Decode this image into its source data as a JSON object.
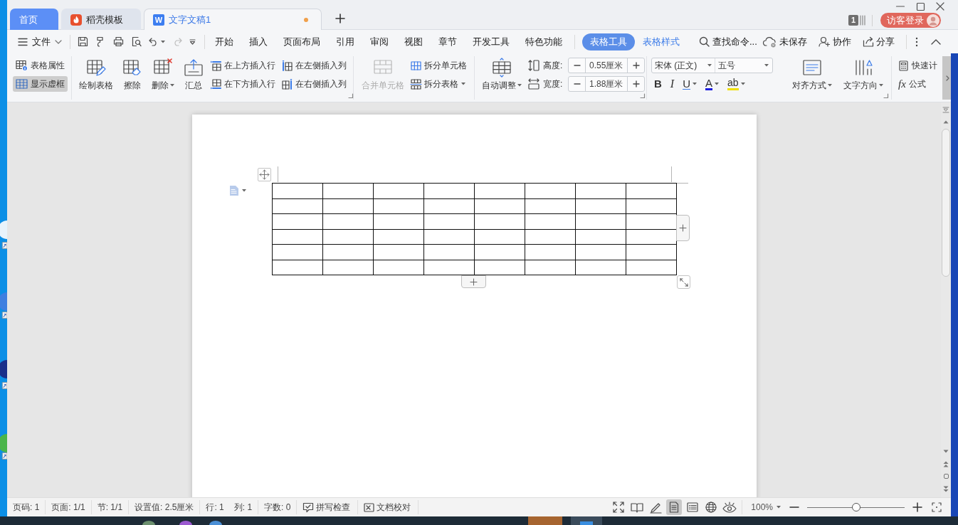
{
  "tabs": [
    {
      "kind": "home",
      "label": "首页",
      "selected": false
    },
    {
      "kind": "docer",
      "label": "稻壳模板",
      "selected": false
    },
    {
      "kind": "writer",
      "logo": "W",
      "label": "文字文稿1",
      "selected": true,
      "unsaved": true
    }
  ],
  "account": {
    "badge": "1",
    "login": "访客登录"
  },
  "menu": {
    "file": "文件",
    "tabs": [
      {
        "label": "开始",
        "selected": false,
        "contextual": false
      },
      {
        "label": "插入",
        "selected": false,
        "contextual": false
      },
      {
        "label": "页面布局",
        "selected": false,
        "contextual": false
      },
      {
        "label": "引用",
        "selected": false,
        "contextual": false
      },
      {
        "label": "审阅",
        "selected": false,
        "contextual": false
      },
      {
        "label": "视图",
        "selected": false,
        "contextual": false
      },
      {
        "label": "章节",
        "selected": false,
        "contextual": false
      },
      {
        "label": "开发工具",
        "selected": false,
        "contextual": false
      },
      {
        "label": "特色功能",
        "selected": false,
        "contextual": false
      },
      {
        "label": "表格工具",
        "selected": true,
        "contextual": true
      },
      {
        "label": "表格样式",
        "selected": false,
        "contextual": true
      }
    ],
    "search": "查找命令...",
    "actions": [
      "未保存",
      "协作",
      "分享"
    ]
  },
  "ribbon": {
    "table_buttons": [
      {
        "label": "表格属性",
        "selected": false
      },
      {
        "label": "显示虚框",
        "selected": true
      }
    ],
    "edit_buttons": [
      {
        "label": "绘制表格",
        "dropdown": false
      },
      {
        "label": "擦除",
        "dropdown": false
      },
      {
        "label": "删除",
        "dropdown": true
      },
      {
        "label": "汇总",
        "dropdown": false
      }
    ],
    "insert_buttons": [
      "在上方插入行",
      "在下方插入行",
      "在左侧插入列",
      "在右侧插入列"
    ],
    "merge_buttons": [
      {
        "label": "合并单元格",
        "disabled": true,
        "dropdown": false
      },
      {
        "label": "拆分单元格",
        "disabled": false,
        "dropdown": false
      },
      {
        "label": "拆分表格",
        "disabled": false,
        "dropdown": true
      }
    ],
    "autofit": {
      "label": "自动调整",
      "dropdown": true
    },
    "size_fields": [
      {
        "label": "高度:",
        "value": "0.55厘米"
      },
      {
        "label": "宽度:",
        "value": "1.88厘米"
      }
    ],
    "font": {
      "family": "宋体 (正文)",
      "size": "五号"
    },
    "format_buttons": [
      {
        "kind": "bold",
        "text": "B",
        "dropdown": false
      },
      {
        "kind": "italic",
        "text": "I",
        "dropdown": false
      },
      {
        "kind": "underline",
        "text": "U",
        "dropdown": true
      },
      {
        "kind": "font_color",
        "text": "A",
        "dropdown": true
      },
      {
        "kind": "highlight",
        "text": "ab",
        "dropdown": true
      }
    ],
    "paragraph_buttons": [
      {
        "label": "对齐方式",
        "dropdown": true
      },
      {
        "label": "文字方向",
        "dropdown": true
      }
    ],
    "calc_buttons": [
      {
        "kind": "calculator",
        "label": "快速计"
      },
      {
        "kind": "formula",
        "symbol": "fx",
        "label": "公式"
      }
    ]
  },
  "document": {
    "table": {
      "rows": [
        [
          {},
          {},
          {},
          {},
          {},
          {},
          {},
          {}
        ],
        [
          {},
          {},
          {},
          {},
          {},
          {},
          {},
          {}
        ],
        [
          {},
          {},
          {},
          {},
          {},
          {},
          {},
          {}
        ],
        [
          {},
          {},
          {},
          {},
          {},
          {},
          {},
          {}
        ],
        [
          {},
          {},
          {},
          {},
          {},
          {},
          {},
          {}
        ],
        [
          {},
          {},
          {},
          {},
          {},
          {},
          {},
          {}
        ]
      ]
    }
  },
  "status_bar": {
    "segments": [
      [
        "页码: 1"
      ],
      [
        "页面: 1/1"
      ],
      [
        "节: 1/1"
      ],
      [
        "设置值: 2.5厘米"
      ],
      [
        "行: 1",
        "列: 1"
      ],
      [
        "字数: 0"
      ]
    ],
    "tools": [
      "拼写检查",
      "文档校对"
    ],
    "views": [
      {
        "selected": false
      },
      {
        "selected": false
      },
      {
        "selected": false
      },
      {
        "selected": true
      },
      {
        "selected": false
      },
      {
        "selected": false
      },
      {
        "selected": false
      }
    ],
    "zoom": {
      "label": "100%",
      "level": 0.5
    }
  }
}
